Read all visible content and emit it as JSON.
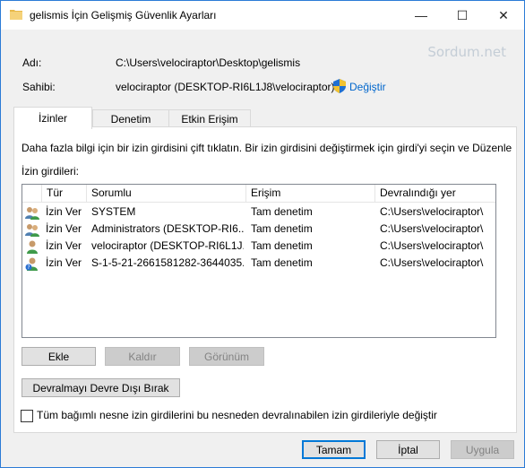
{
  "window": {
    "title": "gelismis İçin Gelişmiş Güvenlik Ayarları",
    "controls": {
      "minimize": "—",
      "maximize": "☐",
      "close": "✕"
    }
  },
  "watermark": "Sordum.net",
  "name_field": {
    "label": "Adı:",
    "value": "C:\\Users\\velociraptor\\Desktop\\gelismis"
  },
  "owner_field": {
    "label": "Sahibi:",
    "value": "velociraptor (DESKTOP-RI6L1J8\\velociraptor)",
    "change_link": "Değiştir"
  },
  "tabs": [
    {
      "label": "İzinler",
      "active": true
    },
    {
      "label": "Denetim",
      "active": false
    },
    {
      "label": "Etkin Erişim",
      "active": false
    }
  ],
  "info_text": "Daha fazla bilgi için bir izin girdisini çift tıklatın. Bir izin girdisini değiştirmek için girdi'yi seçin ve Düzenle",
  "entries_label": "İzin girdileri:",
  "columns": [
    "Tür",
    "Sorumlu",
    "Erişim",
    "Devralındığı yer"
  ],
  "rows": [
    {
      "icon": "user-group-icon",
      "type": "İzin Ver",
      "principal": "SYSTEM",
      "access": "Tam denetim",
      "inherited": "C:\\Users\\velociraptor\\"
    },
    {
      "icon": "user-group-icon",
      "type": "İzin Ver",
      "principal": "Administrators (DESKTOP-RI6...",
      "access": "Tam denetim",
      "inherited": "C:\\Users\\velociraptor\\"
    },
    {
      "icon": "user-icon",
      "type": "İzin Ver",
      "principal": "velociraptor (DESKTOP-RI6L1J...",
      "access": "Tam denetim",
      "inherited": "C:\\Users\\velociraptor\\"
    },
    {
      "icon": "unknown-user-icon",
      "type": "İzin Ver",
      "principal": "S-1-5-21-2661581282-3644035...",
      "access": "Tam denetim",
      "inherited": "C:\\Users\\velociraptor\\"
    }
  ],
  "buttons": {
    "add": "Ekle",
    "remove": "Kaldır",
    "view": "Görünüm",
    "disable_inheritance": "Devralmayı Devre Dışı Bırak",
    "ok": "Tamam",
    "cancel": "İptal",
    "apply": "Uygula"
  },
  "replace_checkbox": {
    "label": "Tüm bağımlı nesne izin girdilerini bu nesneden devralınabilen izin girdileriyle değiştir",
    "checked": false
  }
}
